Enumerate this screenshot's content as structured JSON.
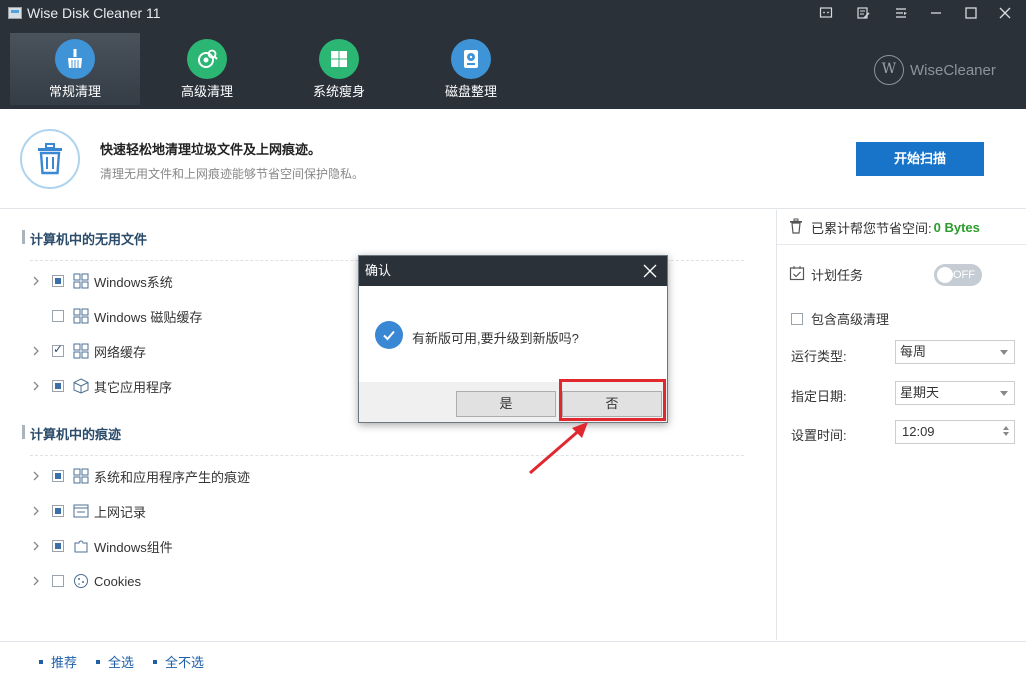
{
  "window": {
    "title": "Wise Disk Cleaner 11"
  },
  "nav": [
    {
      "label": "常规清理",
      "icon": "broom-icon"
    },
    {
      "label": "高级清理",
      "icon": "disk-search-icon"
    },
    {
      "label": "系统瘦身",
      "icon": "windows-icon"
    },
    {
      "label": "磁盘整理",
      "icon": "defrag-disk-icon"
    }
  ],
  "brand": "WiseCleaner",
  "info": {
    "title": "快速轻松地清理垃圾文件及上网痕迹。",
    "subtitle": "清理无用文件和上网痕迹能够节省空间保护隐私。",
    "start_button": "开始扫描"
  },
  "sections": [
    {
      "heading": "计算机中的无用文件",
      "items": [
        {
          "label": "Windows系统",
          "check": "partial",
          "expandable": true,
          "icon": "windows-tiles-icon"
        },
        {
          "label": "Windows 磁贴缓存",
          "check": "none",
          "expandable": false,
          "icon": "windows-tiles-icon"
        },
        {
          "label": "网络缓存",
          "check": "checked",
          "expandable": true,
          "icon": "windows-tiles-icon"
        },
        {
          "label": "其它应用程序",
          "check": "partial",
          "expandable": true,
          "icon": "package-icon"
        }
      ]
    },
    {
      "heading": "计算机中的痕迹",
      "items": [
        {
          "label": "系统和应用程序产生的痕迹",
          "check": "partial",
          "expandable": true,
          "icon": "windows-tiles-icon"
        },
        {
          "label": "上网记录",
          "check": "partial",
          "expandable": true,
          "icon": "browser-history-icon"
        },
        {
          "label": "Windows组件",
          "check": "partial",
          "expandable": true,
          "icon": "puzzle-icon"
        },
        {
          "label": "Cookies",
          "check": "none",
          "expandable": true,
          "icon": "cookie-icon"
        }
      ]
    }
  ],
  "right": {
    "saved_label": "已累计帮您节省空间:",
    "saved_value": "0 Bytes",
    "schedule_label": "计划任务",
    "toggle_text": "OFF",
    "include_advanced": "包含高级清理",
    "run_type_label": "运行类型:",
    "run_type_value": "每周",
    "day_label": "指定日期:",
    "day_value": "星期天",
    "time_label": "设置时间:",
    "time_value": "12:09"
  },
  "footer": {
    "recommend": "推荐",
    "select_all": "全选",
    "select_none": "全不选"
  },
  "dialog": {
    "title": "确认",
    "message": "有新版可用,要升级到新版吗?",
    "yes": "是",
    "no": "否"
  },
  "colors": {
    "header_bg": "#2a3139",
    "accent": "#1874c9",
    "saved_green": "#2c9c2c",
    "annotation_red": "#e0282e"
  }
}
